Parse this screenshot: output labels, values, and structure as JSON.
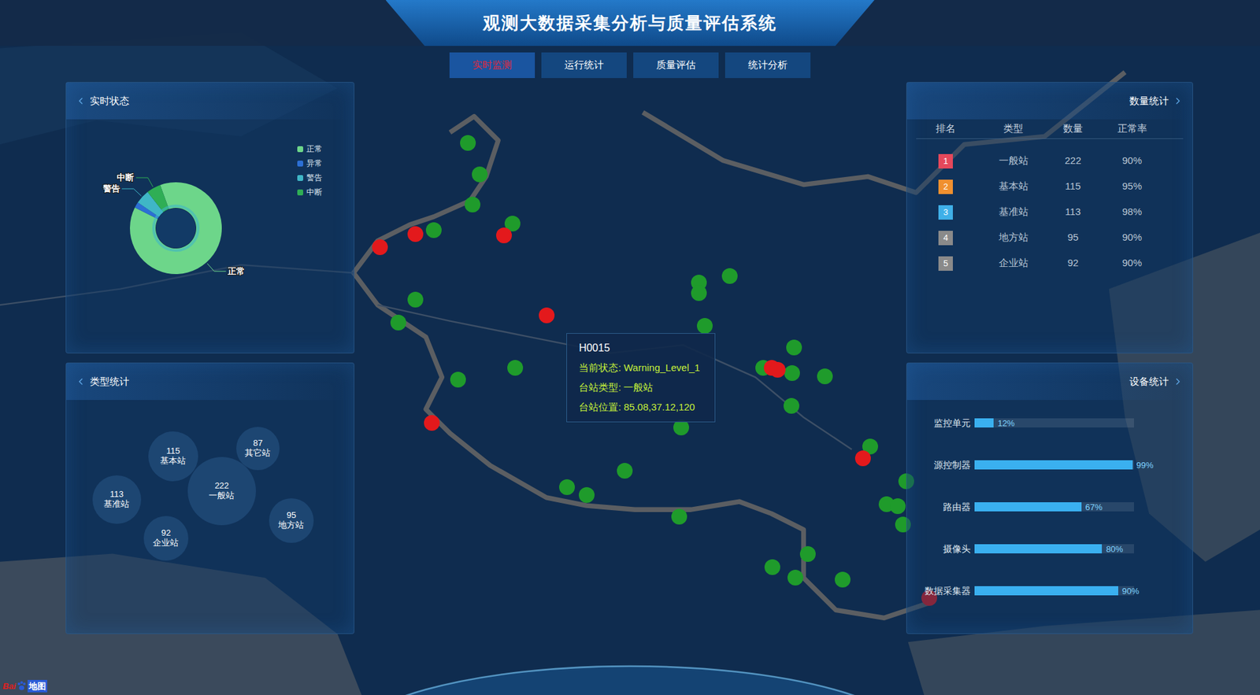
{
  "header": {
    "title": "观测大数据采集分析与质量评估系统"
  },
  "tabs": [
    {
      "label": "实时监测",
      "selected": true
    },
    {
      "label": "运行统计",
      "selected": false
    },
    {
      "label": "质量评估",
      "selected": false
    },
    {
      "label": "统计分析",
      "selected": false
    }
  ],
  "status_panel": {
    "title": "实时状态",
    "segments": [
      {
        "name": "正常",
        "value": 0.88,
        "color": "#6dd68a",
        "label_shown": true
      },
      {
        "name": "异常",
        "value": 0.02,
        "color": "#2c6fd4",
        "label_shown": false
      },
      {
        "name": "警告",
        "value": 0.05,
        "color": "#3fb6c6",
        "label_shown": true
      },
      {
        "name": "中断",
        "value": 0.05,
        "color": "#2fae55",
        "label_shown": true
      }
    ]
  },
  "type_panel": {
    "title": "类型统计",
    "bubbles": [
      {
        "value": "115",
        "name": "基本站"
      },
      {
        "value": "87",
        "name": "其它站"
      },
      {
        "value": "113",
        "name": "基准站"
      },
      {
        "value": "222",
        "name": "一般站"
      },
      {
        "value": "95",
        "name": "地方站"
      },
      {
        "value": "92",
        "name": "企业站"
      }
    ]
  },
  "count_panel": {
    "title": "数量统计",
    "columns": [
      "排名",
      "类型",
      "数量",
      "正常率"
    ],
    "rows": [
      {
        "rank": "1",
        "type": "一般站",
        "count": "222",
        "rate": "90%",
        "color": "#e5485b"
      },
      {
        "rank": "2",
        "type": "基本站",
        "count": "115",
        "rate": "95%",
        "color": "#f0902f"
      },
      {
        "rank": "3",
        "type": "基准站",
        "count": "113",
        "rate": "98%",
        "color": "#3fb0e8"
      },
      {
        "rank": "4",
        "type": "地方站",
        "count": "95",
        "rate": "90%",
        "color": "#8a8a8a"
      },
      {
        "rank": "5",
        "type": "企业站",
        "count": "92",
        "rate": "90%",
        "color": "#8a8a8a"
      }
    ]
  },
  "device_panel": {
    "title": "设备统计",
    "rows": [
      {
        "name": "监控单元",
        "level": 0.12,
        "reading": "12%"
      },
      {
        "name": "源控制器",
        "level": 0.99,
        "reading": "99%"
      },
      {
        "name": "路由器",
        "level": 0.67,
        "reading": "67%"
      },
      {
        "name": "摄像头",
        "level": 0.8,
        "reading": "80%"
      },
      {
        "name": "数据采集器",
        "level": 0.9,
        "reading": "90%"
      }
    ]
  },
  "stations": [
    {
      "lon": 80.46,
      "lat": 44.54,
      "status": "normal",
      "color": "#1f9b2b",
      "hovered": false
    },
    {
      "lon": 81.16,
      "lat": 43.19,
      "status": "normal",
      "color": "#1f9b2b",
      "hovered": false
    },
    {
      "lon": 80.74,
      "lat": 41.88,
      "status": "normal",
      "color": "#1f9b2b",
      "hovered": false
    },
    {
      "lon": 78.49,
      "lat": 40.78,
      "status": "normal",
      "color": "#1f9b2b",
      "hovered": false
    },
    {
      "lon": 83.09,
      "lat": 41.06,
      "status": "normal",
      "color": "#1f9b2b",
      "hovered": false
    },
    {
      "lon": 77.41,
      "lat": 37.81,
      "status": "normal",
      "color": "#1f9b2b",
      "hovered": false
    },
    {
      "lon": 76.42,
      "lat": 36.81,
      "status": "normal",
      "color": "#1f9b2b",
      "hovered": false
    },
    {
      "lon": 79.9,
      "lat": 34.37,
      "status": "normal",
      "color": "#1f9b2b",
      "hovered": false
    },
    {
      "lon": 83.23,
      "lat": 34.88,
      "status": "normal",
      "color": "#1f9b2b",
      "hovered": false
    },
    {
      "lon": 93.98,
      "lat": 38.54,
      "status": "normal",
      "color": "#1f9b2b",
      "hovered": false
    },
    {
      "lon": 93.98,
      "lat": 38.09,
      "status": "normal",
      "color": "#1f9b2b",
      "hovered": false
    },
    {
      "lon": 95.77,
      "lat": 38.81,
      "status": "normal",
      "color": "#1f9b2b",
      "hovered": false
    },
    {
      "lon": 94.31,
      "lat": 36.68,
      "status": "normal",
      "color": "#1f9b2b",
      "hovered": false
    },
    {
      "lon": 99.52,
      "lat": 35.75,
      "status": "normal",
      "color": "#1f9b2b",
      "hovered": false
    },
    {
      "lon": 97.74,
      "lat": 34.88,
      "status": "normal",
      "color": "#1f9b2b",
      "hovered": false
    },
    {
      "lon": 99.43,
      "lat": 34.64,
      "status": "normal",
      "color": "#1f9b2b",
      "hovered": false
    },
    {
      "lon": 101.35,
      "lat": 34.5,
      "status": "normal",
      "color": "#1f9b2b",
      "hovered": false
    },
    {
      "lon": 99.38,
      "lat": 33.23,
      "status": "normal",
      "color": "#1f9b2b",
      "hovered": false
    },
    {
      "lon": 92.95,
      "lat": 32.3,
      "status": "normal",
      "color": "#1f9b2b",
      "hovered": false
    },
    {
      "lon": 89.62,
      "lat": 30.44,
      "status": "normal",
      "color": "#1f9b2b",
      "hovered": false
    },
    {
      "lon": 86.28,
      "lat": 29.75,
      "status": "normal",
      "color": "#1f9b2b",
      "hovered": false
    },
    {
      "lon": 87.41,
      "lat": 29.4,
      "status": "normal",
      "color": "#1f9b2b",
      "hovered": false
    },
    {
      "lon": 92.81,
      "lat": 28.47,
      "status": "normal",
      "color": "#1f9b2b",
      "hovered": false
    },
    {
      "lon": 103.98,
      "lat": 31.5,
      "status": "normal",
      "color": "#1f9b2b",
      "hovered": false
    },
    {
      "lon": 106.09,
      "lat": 29.99,
      "status": "normal",
      "color": "#1f9b2b",
      "hovered": false
    },
    {
      "lon": 104.92,
      "lat": 29.02,
      "status": "normal",
      "color": "#1f9b2b",
      "hovered": false
    },
    {
      "lon": 105.58,
      "lat": 28.92,
      "status": "normal",
      "color": "#1f9b2b",
      "hovered": false
    },
    {
      "lon": 105.91,
      "lat": 28.13,
      "status": "normal",
      "color": "#1f9b2b",
      "hovered": false
    },
    {
      "lon": 100.32,
      "lat": 26.88,
      "status": "normal",
      "color": "#1f9b2b",
      "hovered": false
    },
    {
      "lon": 98.25,
      "lat": 26.3,
      "status": "normal",
      "color": "#1f9b2b",
      "hovered": false
    },
    {
      "lon": 99.62,
      "lat": 25.85,
      "status": "normal",
      "color": "#1f9b2b",
      "hovered": false
    },
    {
      "lon": 102.38,
      "lat": 25.78,
      "status": "normal",
      "color": "#1f9b2b",
      "hovered": false
    },
    {
      "lon": 75.34,
      "lat": 40.06,
      "status": "warning",
      "color": "#e3191c",
      "hovered": false
    },
    {
      "lon": 77.41,
      "lat": 40.61,
      "status": "warning",
      "color": "#e3191c",
      "hovered": false
    },
    {
      "lon": 82.57,
      "lat": 40.57,
      "status": "warning",
      "color": "#e3191c",
      "hovered": false
    },
    {
      "lon": 85.08,
      "lat": 37.12,
      "status": "warning",
      "color": "#e3191c",
      "hovered": true
    },
    {
      "lon": 78.35,
      "lat": 32.5,
      "status": "warning",
      "color": "#e3191c",
      "hovered": false
    },
    {
      "lon": 98.21,
      "lat": 34.88,
      "status": "warning",
      "color": "#e3191c",
      "hovered": false
    },
    {
      "lon": 98.58,
      "lat": 34.78,
      "status": "warning",
      "color": "#e3191c",
      "hovered": false
    },
    {
      "lon": 103.56,
      "lat": 30.99,
      "status": "warning",
      "color": "#e3191c",
      "hovered": false
    },
    {
      "lon": 107.41,
      "lat": 24.99,
      "status": "warning",
      "color": "#e3191c",
      "hovered": false
    }
  ],
  "tooltip": {
    "title": "H0015",
    "lines": [
      "当前状态: Warning_Level_1",
      "台站类型: 一般站",
      "台站位置: 85.08,37.12,120"
    ]
  },
  "map_logo": {
    "brand": "Bai",
    "name": "地图"
  }
}
